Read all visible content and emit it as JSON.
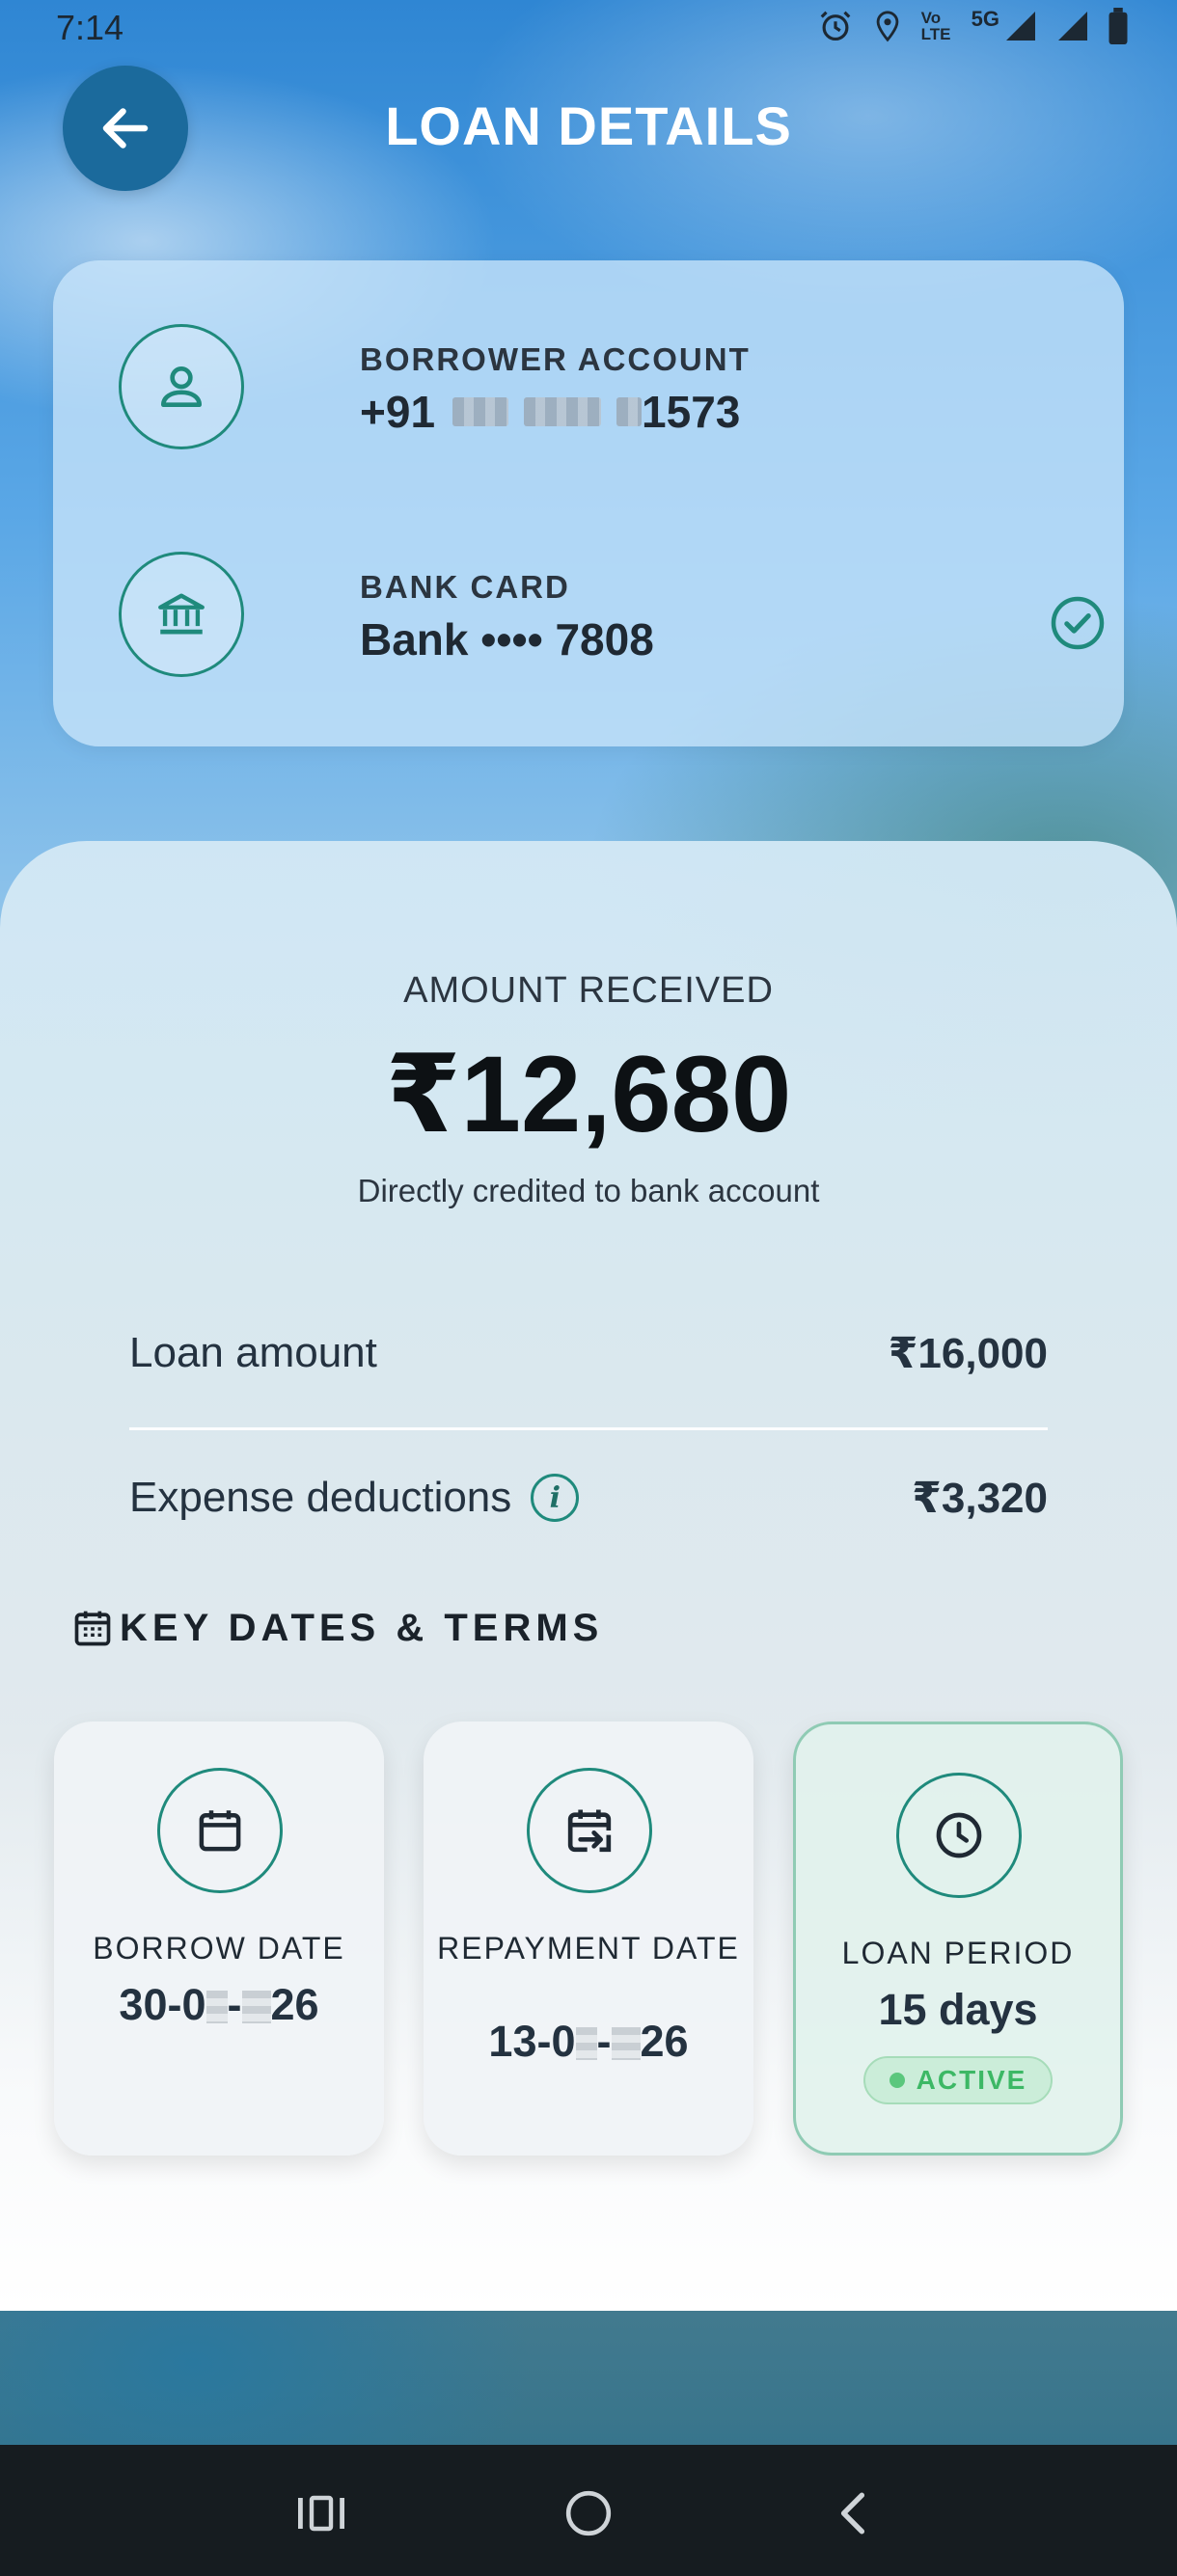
{
  "status_bar": {
    "time": "7:14",
    "volte": "Vo LTE",
    "network": "5G"
  },
  "header": {
    "title": "LOAN DETAILS"
  },
  "account": {
    "borrower_label": "BORROWER ACCOUNT",
    "borrower_prefix": "+91",
    "borrower_suffix": "1573",
    "bank_label": "BANK CARD",
    "bank_value": "Bank •••• 7808"
  },
  "summary": {
    "amount_label": "AMOUNT RECEIVED",
    "amount_value": "₹12,680",
    "amount_note": "Directly credited to bank account",
    "rows": [
      {
        "label": "Loan amount",
        "value": "₹16,000"
      },
      {
        "label": "Expense deductions",
        "value": "₹3,320"
      }
    ]
  },
  "terms": {
    "section_title": "KEY DATES & TERMS",
    "borrow": {
      "label": "BORROW DATE",
      "value_start": "30-0",
      "value_end": "26"
    },
    "repayment": {
      "label": "REPAYMENT DATE",
      "value_start": "13-0",
      "value_end": "26"
    },
    "period": {
      "label": "LOAN PERIOD",
      "value": "15 days",
      "status": "ACTIVE"
    }
  },
  "colors": {
    "accent": "#1f8a7c",
    "back_button": "#1b6a9c",
    "active": "#3cb865"
  },
  "icons": {
    "back": "arrow-left-icon",
    "person": "person-icon",
    "bank": "bank-icon",
    "check": "check-circle-icon",
    "info": "info-icon",
    "calendar": "calendar-icon",
    "repay": "calendar-arrow-icon",
    "clock": "clock-icon"
  }
}
